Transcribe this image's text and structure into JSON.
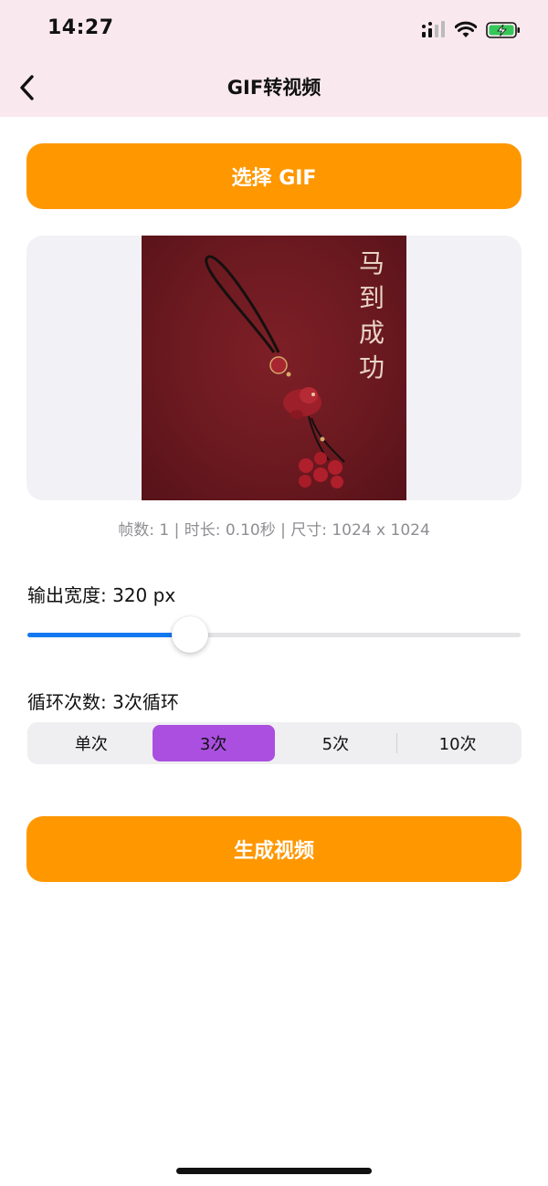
{
  "status_bar": {
    "time": "14:27"
  },
  "nav": {
    "title": "GIF转视频",
    "back_icon": "chevron-left-icon"
  },
  "select_button": {
    "label": "选择 GIF"
  },
  "preview": {
    "caption_chars": [
      "马",
      "到",
      "成",
      "功"
    ]
  },
  "gif_info": "帧数: 1 | 时长: 0.10秒 | 尺寸: 1024 x 1024",
  "output_width": {
    "label": "输出宽度: 320 px",
    "slider_fraction": 0.33
  },
  "loop": {
    "label": "循环次数: 3次循环",
    "options": [
      "单次",
      "3次",
      "5次",
      "10次"
    ],
    "selected_index": 1
  },
  "generate_button": {
    "label": "生成视频"
  },
  "colors": {
    "accent_orange": "#ff9700",
    "slider_blue": "#1478f0",
    "segment_selected": "#aa4fe0",
    "header_bg": "#f9e9ef"
  }
}
